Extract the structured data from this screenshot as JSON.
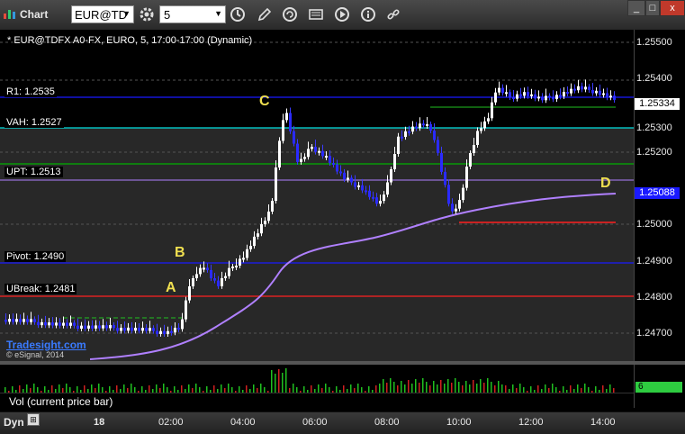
{
  "window": {
    "title": "Chart",
    "minimize": "_",
    "maximize": "□",
    "close": "x"
  },
  "toolbar": {
    "symbol": "EUR@TD",
    "interval": "5",
    "dropdown_arrow": "▼"
  },
  "chart_info": "* EUR@TDFX A0-FX, EURO, 5, 17:00-17:00 (Dynamic)",
  "price_axis": {
    "ticks": [
      "1.25500",
      "1.25400",
      "1.25300",
      "1.25200",
      "1.25100",
      "1.25000",
      "1.24900",
      "1.24800",
      "1.24700"
    ],
    "last_price": "1.25334",
    "ma_price": "1.25088"
  },
  "levels": [
    {
      "label": "R1: 1.2535",
      "color": "#1a1aff"
    },
    {
      "label": "VAH: 1.2527",
      "color": "#00e0e0"
    },
    {
      "label": "UPT: 1.2513",
      "color": "#00b000"
    },
    {
      "label": "Pivot: 1.2490",
      "color": "#1a1aff"
    },
    {
      "label": "UBreak: 1.2481",
      "color": "#ff2020"
    }
  ],
  "wave_labels": [
    "A",
    "B",
    "C",
    "D"
  ],
  "volume": {
    "label": "Vol (current price bar)",
    "value": "6"
  },
  "time_axis": {
    "mode": "Dyn",
    "labels": [
      "18",
      "02:00",
      "04:00",
      "06:00",
      "08:00",
      "10:00",
      "12:00",
      "14:00"
    ]
  },
  "watermark": "Tradesight.com",
  "copyright": "© eSignal, 2014",
  "colors": {
    "up_bar": "#ffffff",
    "down_bar": "#2a2aff",
    "ma": "#b080ff",
    "count_magenta": "#ff20ff",
    "count_green": "#20c020"
  }
}
